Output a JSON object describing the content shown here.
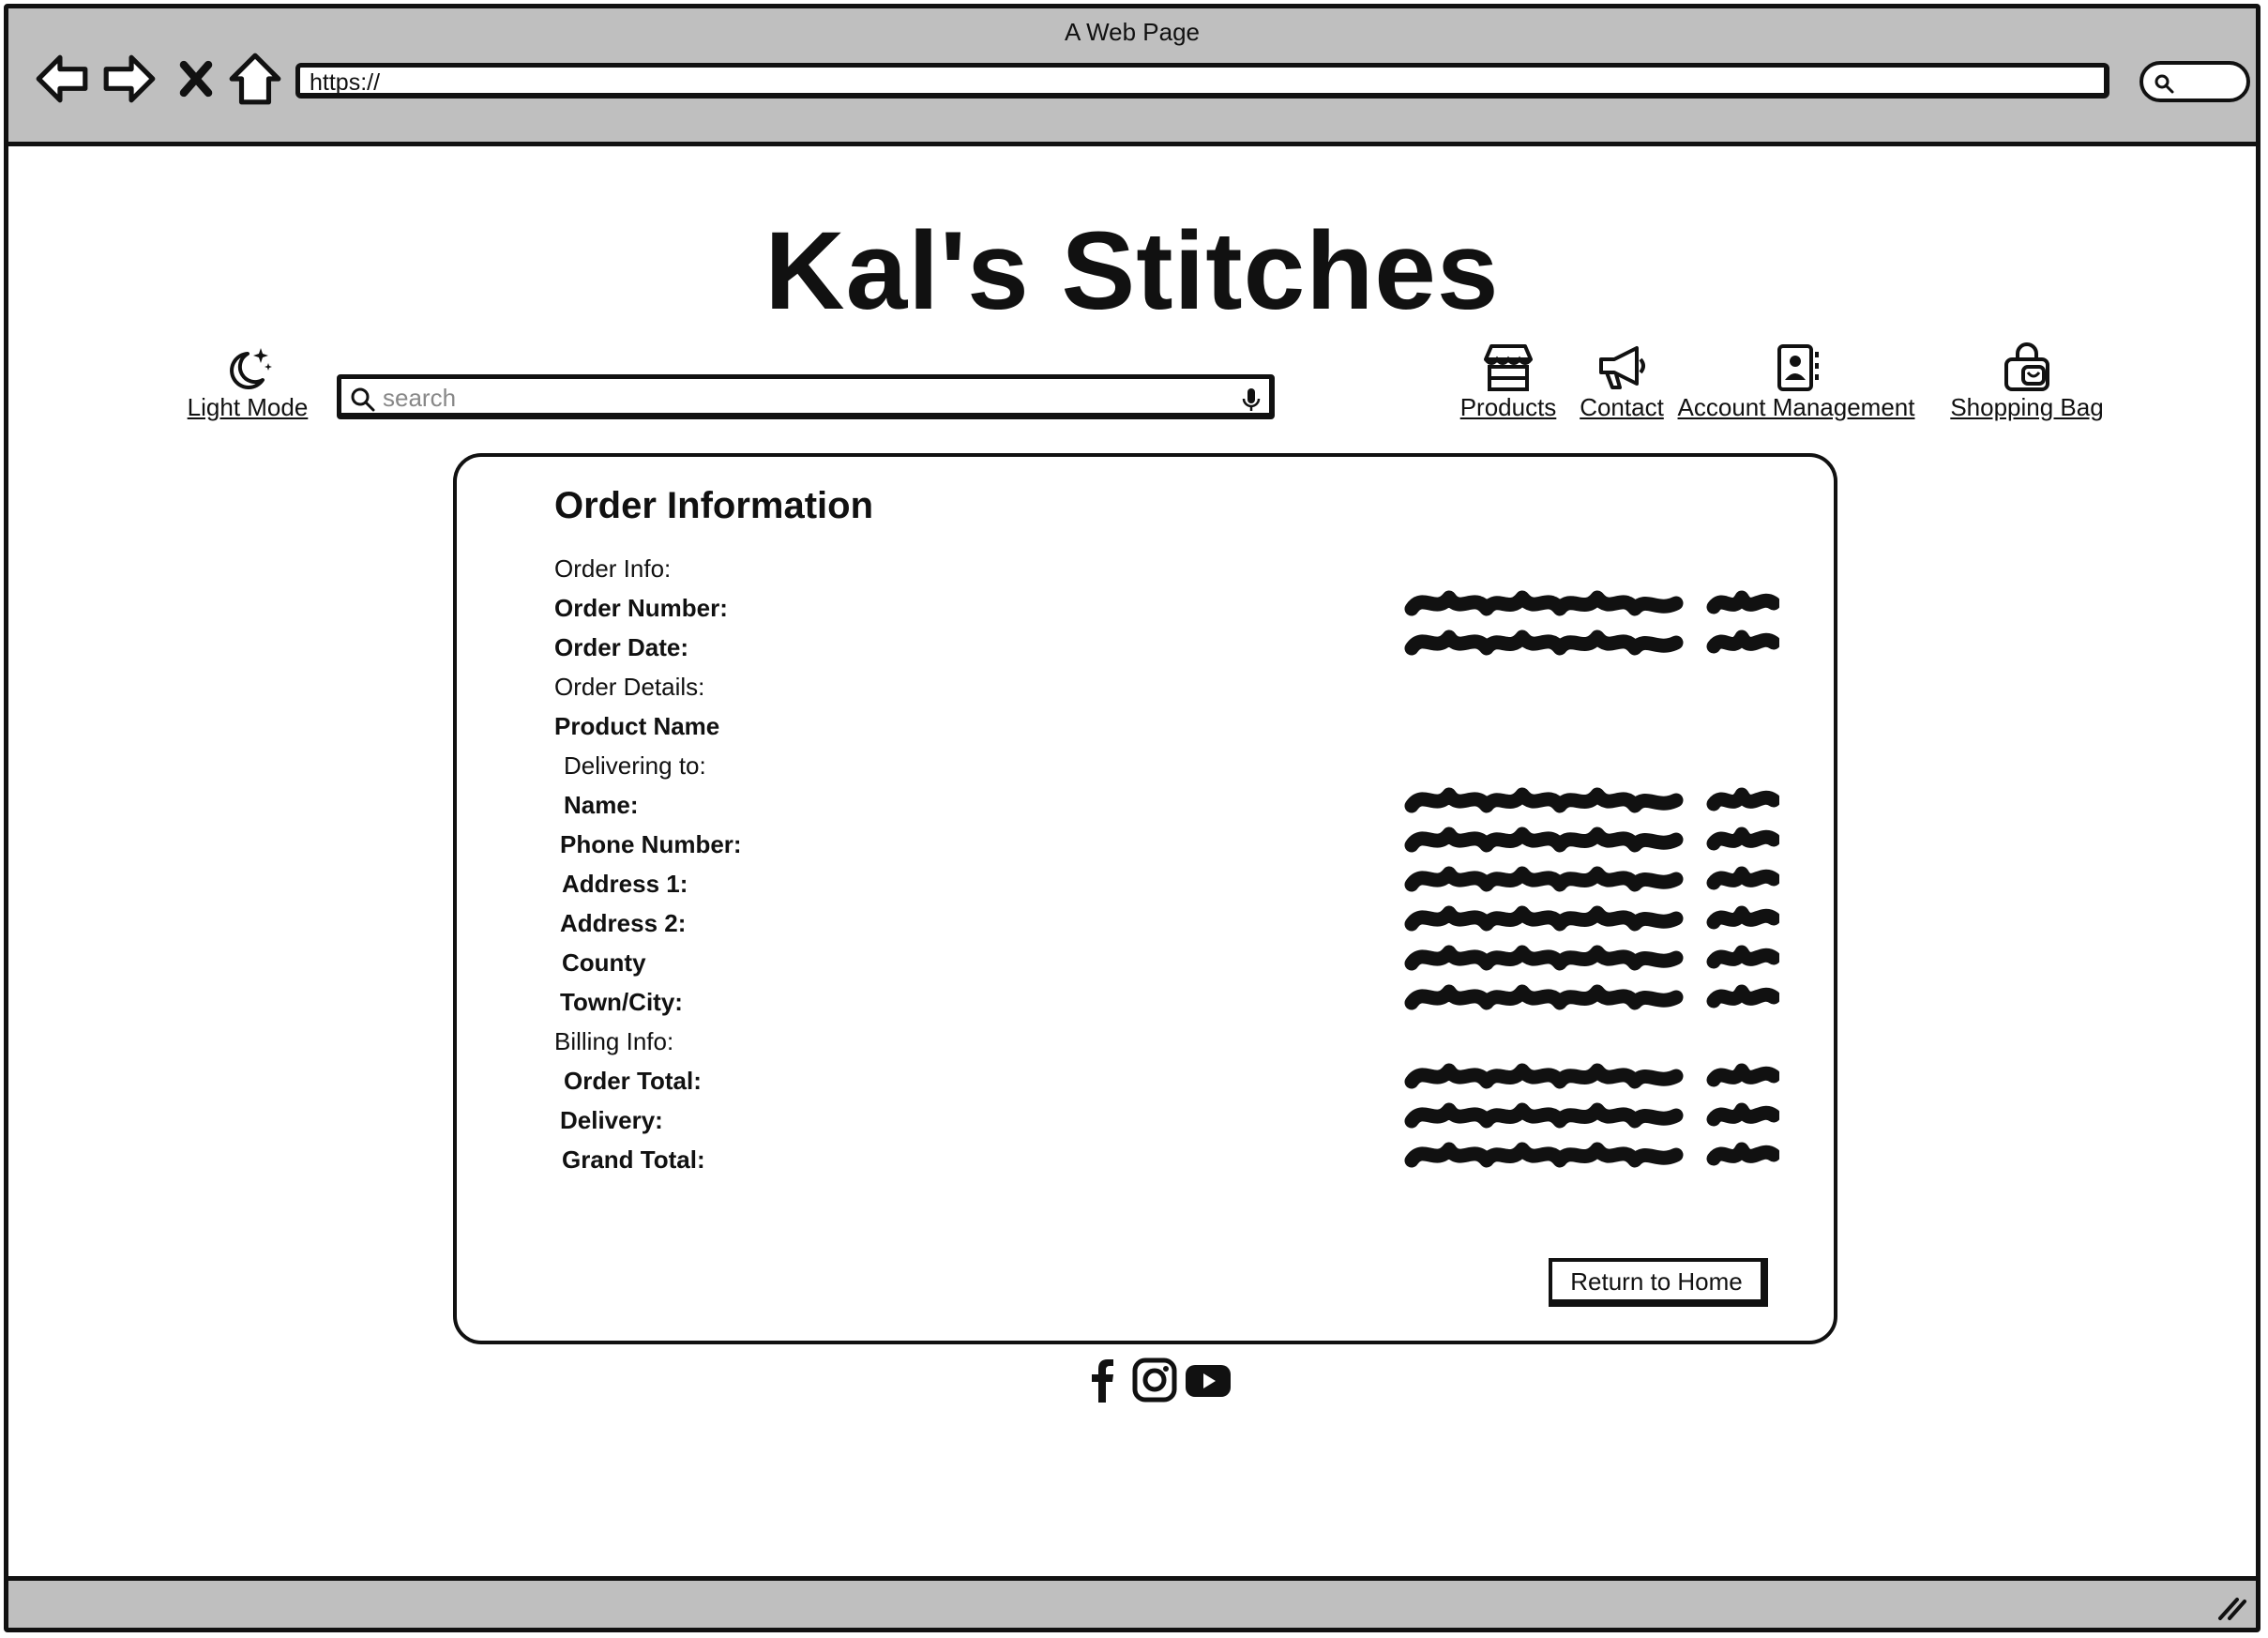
{
  "window": {
    "title": "A Web Page"
  },
  "browser": {
    "url": "https://",
    "icons": [
      "back-arrow-icon",
      "forward-arrow-icon",
      "close-x-icon",
      "home-icon",
      "search-icon"
    ]
  },
  "site": {
    "brand": "Kal's Stitches",
    "mode_toggle_label": "Light Mode",
    "search_placeholder": "search",
    "nav": [
      {
        "label": "Products",
        "icon": "storefront-icon"
      },
      {
        "label": "Contact",
        "icon": "megaphone-icon"
      },
      {
        "label": "Account Management",
        "icon": "contact-book-icon"
      },
      {
        "label": "Shopping Bag",
        "icon": "shopping-bag-icon"
      }
    ]
  },
  "order": {
    "title": "Order Information",
    "rows": [
      {
        "label": "Order Info:",
        "bold": false
      },
      {
        "label": "Order Number:",
        "bold": true
      },
      {
        "label": "Order Date:",
        "bold": true
      },
      {
        "label": "Order Details:",
        "bold": false
      },
      {
        "label": "Product Name",
        "bold": true
      },
      {
        "label": "Delivering to:",
        "bold": false
      },
      {
        "label": "Name:",
        "bold": true
      },
      {
        "label": "Phone Number:",
        "bold": true
      },
      {
        "label": "Address 1:",
        "bold": true
      },
      {
        "label": "Address 2:",
        "bold": true
      },
      {
        "label": "County",
        "bold": true
      },
      {
        "label": "Town/City:",
        "bold": true
      },
      {
        "label": "Billing Info:",
        "bold": false
      },
      {
        "label": "Order Total:",
        "bold": true
      },
      {
        "label": "Delivery:",
        "bold": true
      },
      {
        "label": "Grand Total:",
        "bold": true
      }
    ],
    "return_button": "Return to Home"
  },
  "footer": {
    "social_icons": [
      "facebook-icon",
      "instagram-icon",
      "youtube-icon"
    ]
  }
}
